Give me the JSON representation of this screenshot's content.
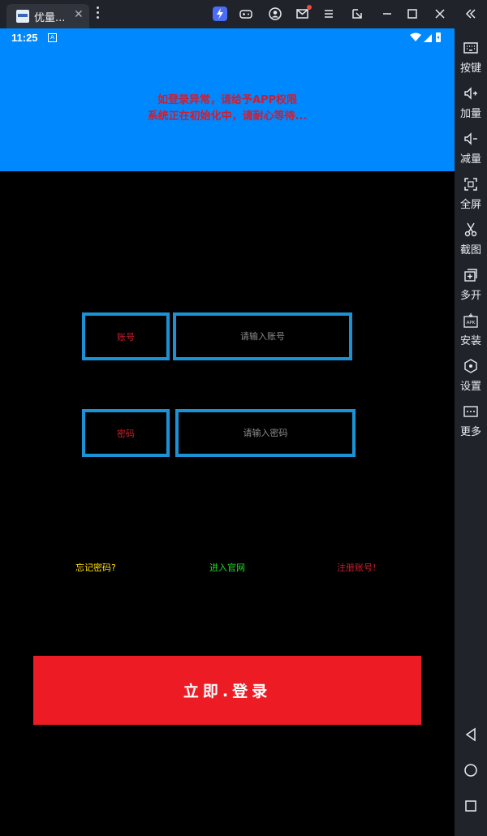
{
  "emulator": {
    "tab_title": "优量...",
    "tab_close": "✕",
    "toolbar_icons": [
      "boost-icon",
      "gamepad-icon",
      "account-icon",
      "mail-icon",
      "menu-icon",
      "popout-icon",
      "minimize-icon",
      "maximize-icon",
      "close-icon",
      "collapse-icon"
    ],
    "sidebar": [
      {
        "icon": "keyboard-icon",
        "label": "按键"
      },
      {
        "icon": "volume-up-icon",
        "label": "加量"
      },
      {
        "icon": "volume-down-icon",
        "label": "减量"
      },
      {
        "icon": "fullscreen-icon",
        "label": "全屏"
      },
      {
        "icon": "scissors-icon",
        "label": "截图"
      },
      {
        "icon": "multi-instance-icon",
        "label": "多开"
      },
      {
        "icon": "apk-icon",
        "label": "安装"
      },
      {
        "icon": "settings-icon",
        "label": "设置"
      },
      {
        "icon": "more-icon",
        "label": "更多"
      }
    ],
    "nav": [
      "back-icon",
      "home-icon",
      "recents-icon"
    ]
  },
  "statusbar": {
    "time": "11:25",
    "a_icon": "A"
  },
  "header": {
    "line1": "如登录异常，请给予APP权限",
    "line2": "系统正在初始化中，请耐心等待..."
  },
  "form": {
    "account_label": "账号",
    "account_placeholder": "请输入账号",
    "password_label": "密码",
    "password_placeholder": "请输入密码"
  },
  "links": {
    "forgot": "忘记密码?",
    "website": "进入官网",
    "register": "注册账号!"
  },
  "login_button": "立即.登录",
  "colors": {
    "header_bg": "#0088ff",
    "notice_text": "#d21c2c",
    "box_border": "#1c92d6",
    "login_bg": "#ed1c24",
    "forgot_color": "#ffe100",
    "website_color": "#1ee01e",
    "register_color": "#d21c2c"
  }
}
